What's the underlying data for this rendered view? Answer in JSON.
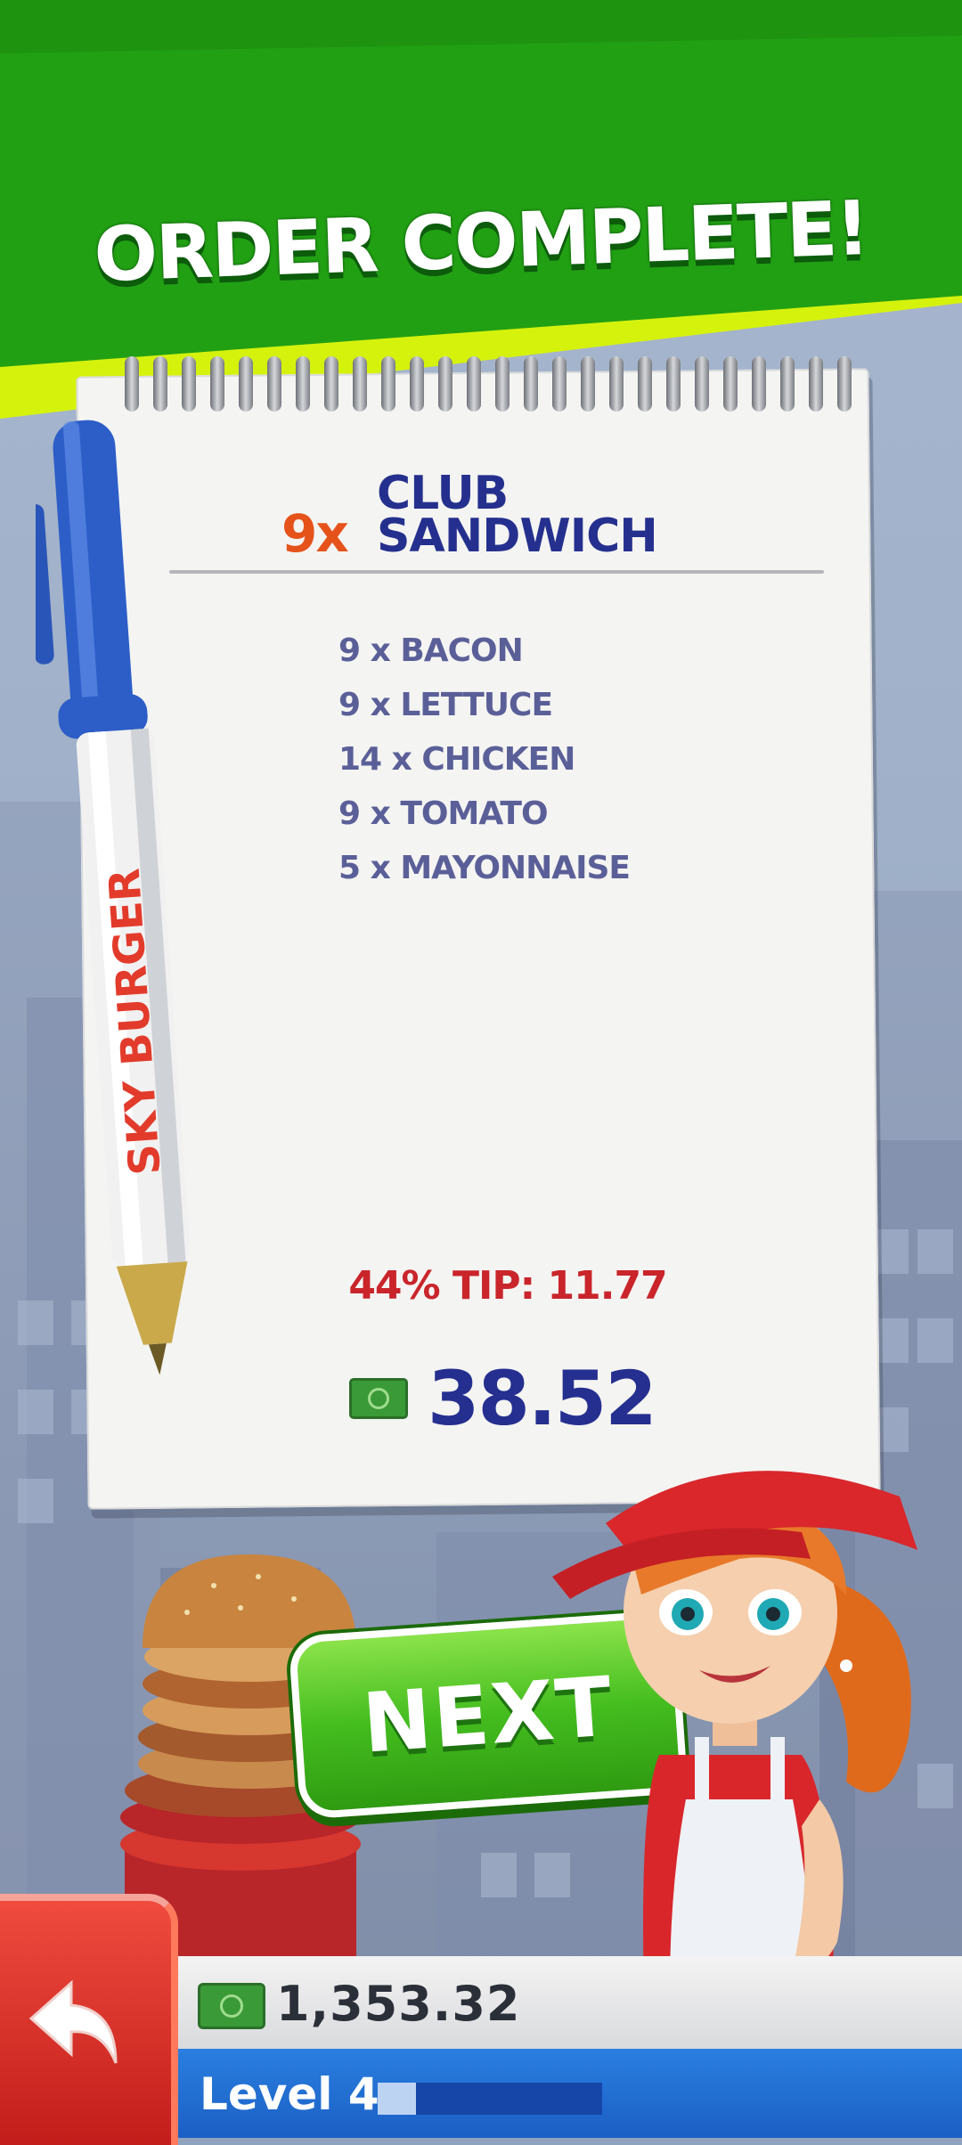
{
  "header": {
    "title": "ORDER COMPLETE!"
  },
  "order": {
    "quantity": "9x",
    "item_line1": "CLUB",
    "item_line2": "SANDWICH",
    "ingredients": [
      "9 x BACON",
      "9 x LETTUCE",
      "14 x CHICKEN",
      "9 x TOMATO",
      "5 x MAYONNAISE"
    ],
    "tip": "44% TIP: 11.77",
    "earned": "38.52",
    "pen_brand": "SKY BURGER"
  },
  "next_button": {
    "label": "NEXT"
  },
  "status_bar": {
    "money": "1,353.32",
    "level_label": "Level 4",
    "level_progress": 0.17
  },
  "colors": {
    "header_green": "#1f9a11",
    "header_lime": "#d5f20d",
    "ink_blue": "#252f8f",
    "tip_red": "#c9252b",
    "qty_orange": "#e5531b"
  },
  "icons": {
    "back": "back-arrow-icon",
    "money": "money-bill-icon"
  }
}
